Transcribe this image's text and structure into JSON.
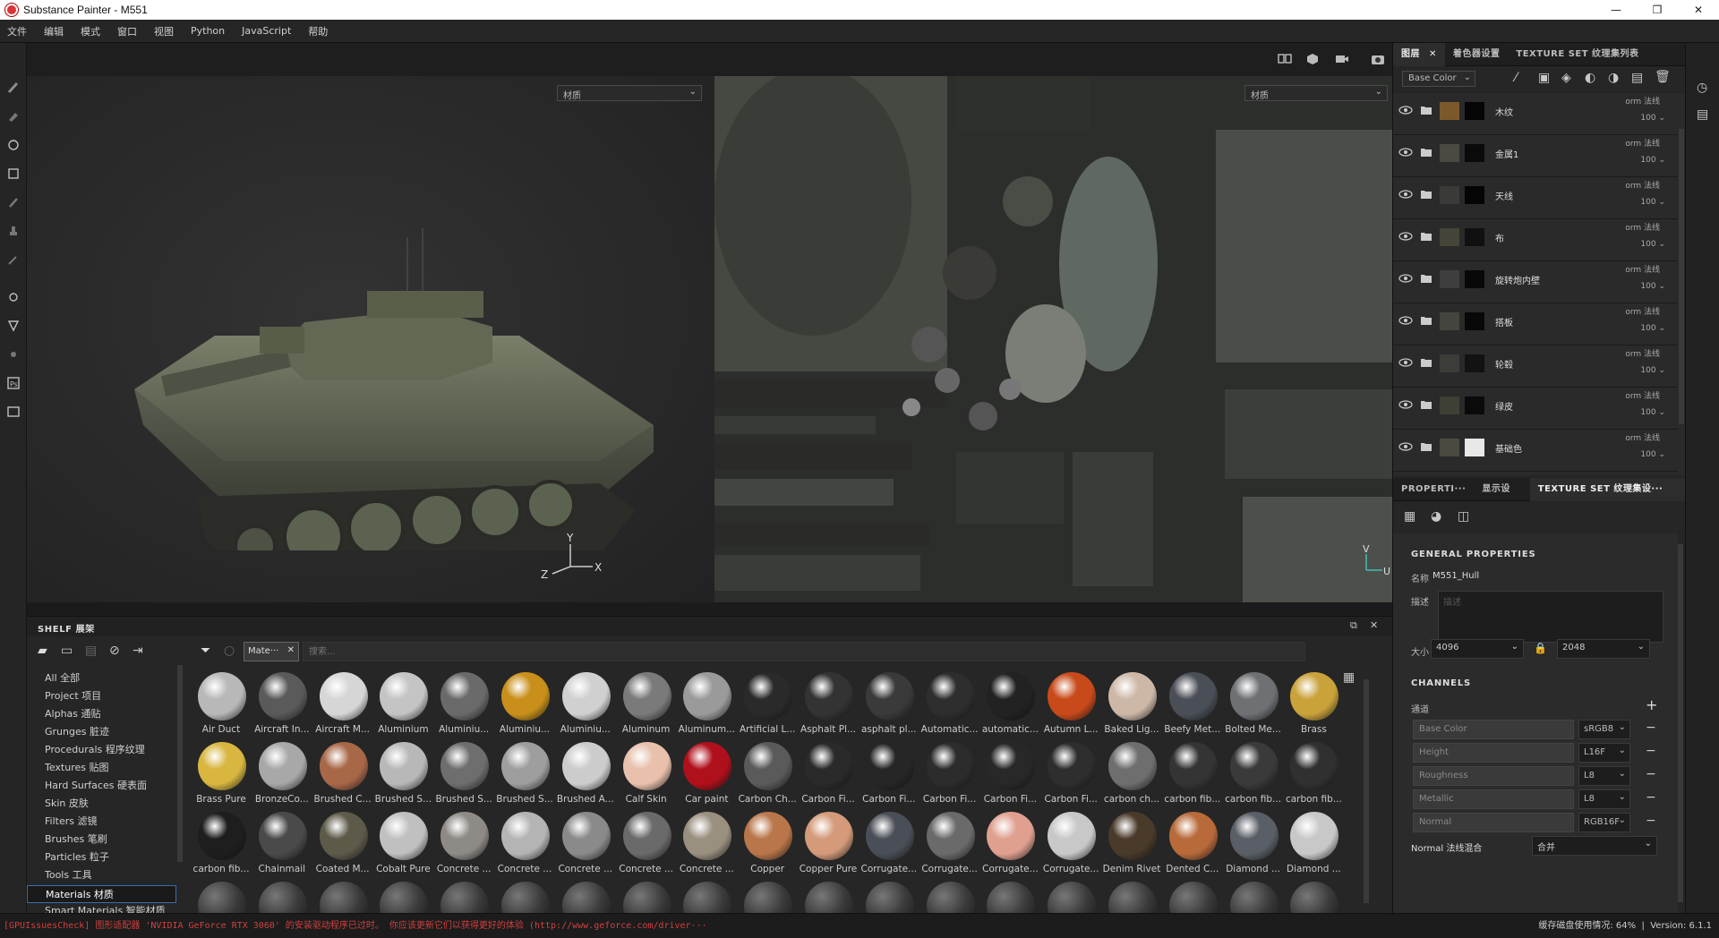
{
  "window": {
    "title": "Substance Painter - M551",
    "controls": [
      "—",
      "❐",
      "✕"
    ]
  },
  "menu": [
    "文件",
    "编辑",
    "模式",
    "窗口",
    "视图",
    "Python",
    "JavaScript",
    "帮助"
  ],
  "viewport": {
    "left_select": "材质",
    "right_select": "材质",
    "axis3d": {
      "x": "X",
      "y": "Y",
      "z": "Z"
    },
    "axis2d": {
      "u": "U",
      "v": "V"
    }
  },
  "right_tabs": {
    "tab_layers": "图层",
    "tab_texset_settings": "着色器设置",
    "tab_texset_list": "TEXTURE SET 纹理集列表"
  },
  "layers": {
    "channel_select": "Base Color",
    "items": [
      {
        "name": "木纹",
        "blend": "orm 法线",
        "opacity": "100",
        "thumb": "#7a5a2a",
        "mask": "#050505"
      },
      {
        "name": "金属1",
        "blend": "orm 法线",
        "opacity": "100",
        "thumb": "#4a4a42",
        "mask": "#0a0a0a"
      },
      {
        "name": "天线",
        "blend": "orm 法线",
        "opacity": "100",
        "thumb": "#3a3a38",
        "mask": "#050505"
      },
      {
        "name": "布",
        "blend": "orm 法线",
        "opacity": "100",
        "thumb": "#444438",
        "mask": "#101010"
      },
      {
        "name": "旋转炮内壁",
        "blend": "orm 法线",
        "opacity": "100",
        "thumb": "#3e3e3e",
        "mask": "#080808"
      },
      {
        "name": "搭板",
        "blend": "orm 法线",
        "opacity": "100",
        "thumb": "#454540",
        "mask": "#080808"
      },
      {
        "name": "轮毂",
        "blend": "orm 法线",
        "opacity": "100",
        "thumb": "#3c3c38",
        "mask": "#121212"
      },
      {
        "name": "绿皮",
        "blend": "orm 法线",
        "opacity": "100",
        "thumb": "#3e4036",
        "mask": "#0a0a0a"
      },
      {
        "name": "基础色",
        "blend": "orm 法线",
        "opacity": "100",
        "thumb": "#4a4a40",
        "mask": "#e8e8e8"
      }
    ]
  },
  "props_tabs": {
    "tab_properties": "PROPERTI···",
    "tab_display": "显示设···",
    "tab_texset": "TEXTURE SET 纹理集设···"
  },
  "properties": {
    "heading": "GENERAL PROPERTIES",
    "name_label": "名称",
    "name_value": "M551_Hull",
    "desc_label": "描述",
    "desc_placeholder": "描述",
    "size_label": "大小",
    "size_w": "4096",
    "size_h": "2048",
    "channels_heading": "CHANNELS",
    "channels_sub": "通道",
    "channels": [
      {
        "name": "Base Color",
        "format": "sRGB8"
      },
      {
        "name": "Height",
        "format": "L16F"
      },
      {
        "name": "Roughness",
        "format": "L8"
      },
      {
        "name": "Metallic",
        "format": "L8"
      },
      {
        "name": "Normal",
        "format": "RGB16F"
      }
    ],
    "normal_mix_label": "Normal 法线混合",
    "normal_mix_value": "合并"
  },
  "shelf": {
    "title": "SHELF 展架",
    "filter_tag": "Mate···",
    "search_placeholder": "搜索...",
    "categories": [
      "All 全部",
      "Project 项目",
      "Alphas 通贴",
      "Grunges 脏迹",
      "Procedurals 程序纹理",
      "Textures 贴图",
      "Hard Surfaces 硬表面",
      "Skin 皮肤",
      "Filters 滤镜",
      "Brushes 笔刷",
      "Particles 粒子",
      "Tools 工具",
      "Materials 材质",
      "Smart Materials 智能材质"
    ],
    "selected_category": "Materials 材质",
    "materials_row1": [
      {
        "label": "Air Duct",
        "color": "#b8b8b8"
      },
      {
        "label": "Aircraft In...",
        "color": "#5a5a5a"
      },
      {
        "label": "Aircraft M...",
        "color": "#d6d6d6"
      },
      {
        "label": "Aluminium",
        "color": "#c4c4c4"
      },
      {
        "label": "Aluminiu...",
        "color": "#6a6a6a"
      },
      {
        "label": "Aluminiu...",
        "color": "#c8901a"
      },
      {
        "label": "Aluminiu...",
        "color": "#d0d0d0"
      },
      {
        "label": "Aluminum",
        "color": "#7a7a7a"
      },
      {
        "label": "Aluminum...",
        "color": "#9a9a9a"
      },
      {
        "label": "Artificial L...",
        "color": "#2a2a2a"
      },
      {
        "label": "Asphalt Pl...",
        "color": "#333333"
      },
      {
        "label": "asphalt pl...",
        "color": "#3a3a3a"
      },
      {
        "label": "Automatic...",
        "color": "#2e2e2e"
      },
      {
        "label": "automatic...",
        "color": "#222222"
      },
      {
        "label": "Autumn L...",
        "color": "#c84a1a"
      },
      {
        "label": "Baked Lig...",
        "color": "#cdb8a8"
      },
      {
        "label": "Beefy Met...",
        "color": "#4a4e56"
      },
      {
        "label": "Bolted Me...",
        "color": "#6e7074"
      },
      {
        "label": "Brass",
        "color": "#c9a23a"
      }
    ],
    "materials_row2": [
      {
        "label": "Brass Pure",
        "color": "#d8b640"
      },
      {
        "label": "BronzeCo...",
        "color": "#a8a8a8"
      },
      {
        "label": "Brushed C...",
        "color": "#a86848"
      },
      {
        "label": "Brushed S...",
        "color": "#b8b8b8"
      },
      {
        "label": "Brushed S...",
        "color": "#6e6e6e"
      },
      {
        "label": "Brushed S...",
        "color": "#9e9e9e"
      },
      {
        "label": "Brushed A...",
        "color": "#cccccc"
      },
      {
        "label": "Calf Skin",
        "color": "#e8c0ac"
      },
      {
        "label": "Car paint",
        "color": "#b0101c"
      },
      {
        "label": "Carbon Ch...",
        "color": "#5a5a5a"
      },
      {
        "label": "Carbon Fi...",
        "color": "#2a2a2a"
      },
      {
        "label": "Carbon Fi...",
        "color": "#262626"
      },
      {
        "label": "Carbon Fi...",
        "color": "#2c2c2c"
      },
      {
        "label": "Carbon Fi...",
        "color": "#282828"
      },
      {
        "label": "Carbon Fi...",
        "color": "#2e2e2e"
      },
      {
        "label": "carbon ch...",
        "color": "#6e6e6e"
      },
      {
        "label": "carbon fib...",
        "color": "#343434"
      },
      {
        "label": "carbon fib...",
        "color": "#3a3a3a"
      },
      {
        "label": "carbon fib...",
        "color": "#303030"
      }
    ],
    "materials_row3": [
      {
        "label": "carbon fib...",
        "color": "#1e1e1e"
      },
      {
        "label": "Chainmail",
        "color": "#4a4a4a"
      },
      {
        "label": "Coated M...",
        "color": "#5e5a4a"
      },
      {
        "label": "Cobalt Pure",
        "color": "#c0c0c0"
      },
      {
        "label": "Concrete ...",
        "color": "#8e8a86"
      },
      {
        "label": "Concrete ...",
        "color": "#b4b4b4"
      },
      {
        "label": "Concrete ...",
        "color": "#8a8a8a"
      },
      {
        "label": "Concrete ...",
        "color": "#6a6a6a"
      },
      {
        "label": "Concrete ...",
        "color": "#9a9080"
      },
      {
        "label": "Copper",
        "color": "#b8764a"
      },
      {
        "label": "Copper Pure",
        "color": "#d49a7a"
      },
      {
        "label": "Corrugate...",
        "color": "#4a4e56"
      },
      {
        "label": "Corrugate...",
        "color": "#6a6a6a"
      },
      {
        "label": "Corrugate...",
        "color": "#e0a090"
      },
      {
        "label": "Corrugate...",
        "color": "#c8c8c8"
      },
      {
        "label": "Denim Rivet",
        "color": "#4a3a2a"
      },
      {
        "label": "Dented C...",
        "color": "#b86a3a"
      },
      {
        "label": "Diamond ...",
        "color": "#5a5e66"
      },
      {
        "label": "Diamond ...",
        "color": "#c8c8c8"
      }
    ]
  },
  "status": {
    "message": "[GPUIssuesCheck] 图形适配器 'NVIDIA GeForce RTX 3060' 的安装驱动程序已过时。 你应该更新它们以获得更好的体验 (http://www.geforce.com/driver···",
    "cache": "缓存磁盘使用情况: 64%",
    "version": "Version: 6.1.1"
  }
}
